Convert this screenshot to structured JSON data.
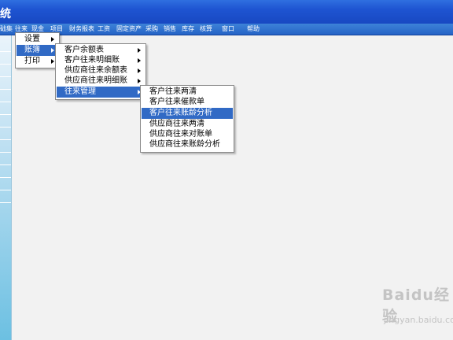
{
  "window": {
    "title": "统"
  },
  "menubar": {
    "items": [
      "础集",
      "往来",
      "现金",
      "项目",
      "财务报表",
      "工资",
      "固定资产",
      "采购",
      "销售",
      "库存",
      "核算",
      "窗口",
      "帮助"
    ]
  },
  "menus": {
    "level1": [
      "设置",
      "账簿",
      "打印"
    ],
    "level2": [
      "客户余额表",
      "客户往来明细账",
      "供应商往来余额表",
      "供应商往来明细账",
      "往来管理"
    ],
    "level3": [
      "客户往来两清",
      "客户往来催款单",
      "客户往来账龄分析",
      "供应商往来两清",
      "供应商往来对账单",
      "供应商往来账龄分析"
    ]
  },
  "watermark": {
    "logo": "Baidu经验",
    "url": "jingyan.baidu.com"
  }
}
